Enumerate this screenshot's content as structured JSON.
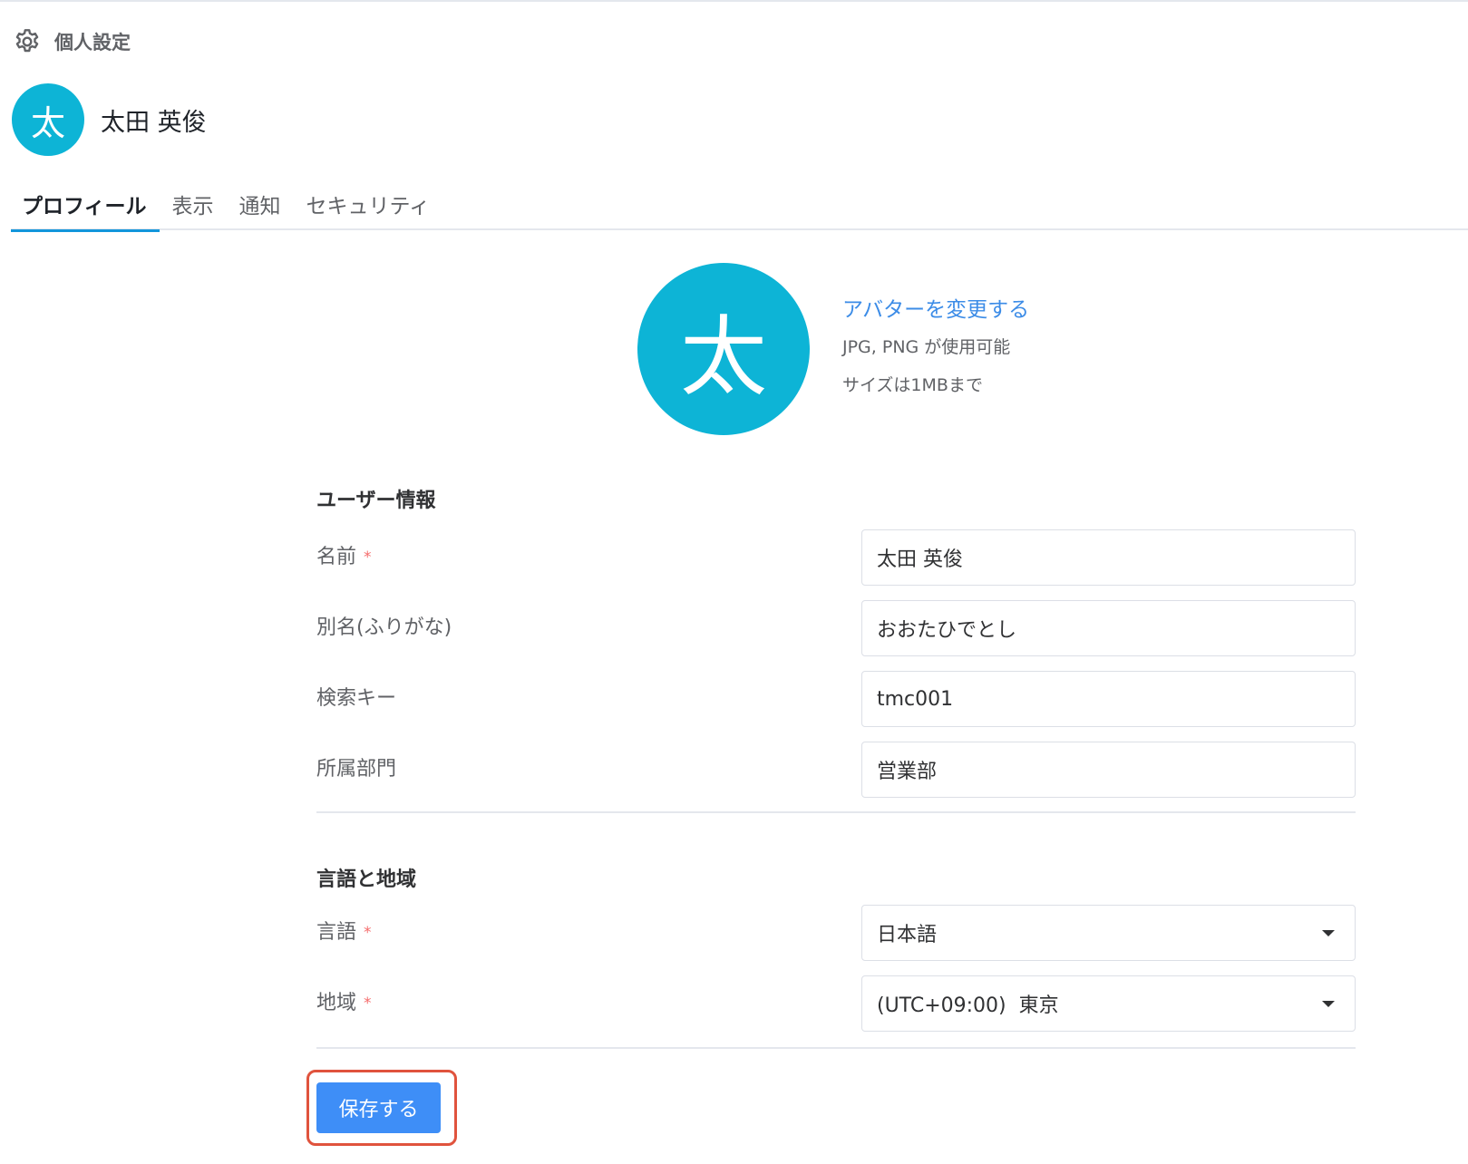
{
  "page": {
    "title": "個人設定",
    "icon": "gear-icon"
  },
  "user": {
    "avatar_char": "太",
    "name": "太田 英俊"
  },
  "tabs": [
    {
      "label": "プロフィール",
      "active": true
    },
    {
      "label": "表示",
      "active": false
    },
    {
      "label": "通知",
      "active": false
    },
    {
      "label": "セキュリティ",
      "active": false
    }
  ],
  "avatar": {
    "change_label": "アバターを変更する",
    "hint_formats": "JPG, PNG が使用可能",
    "hint_size": "サイズは1MBまで"
  },
  "user_info": {
    "title": "ユーザー情報",
    "fields": [
      {
        "label": "名前",
        "required": true,
        "value": "太田 英俊"
      },
      {
        "label": "別名(ふりがな)",
        "required": false,
        "value": "おおたひでとし"
      },
      {
        "label": "検索キー",
        "required": false,
        "value": "tmc001"
      },
      {
        "label": "所属部門",
        "required": false,
        "value": "営業部"
      }
    ]
  },
  "locale": {
    "title": "言語と地域",
    "fields": [
      {
        "label": "言語",
        "required": true,
        "value": "日本語"
      },
      {
        "label": "地域",
        "required": true,
        "value": "(UTC+09:00)  東京"
      }
    ]
  },
  "required_mark": "*",
  "save_label": "保存する",
  "colors": {
    "avatar": "#0db4d6",
    "link": "#3c8ce7",
    "primary_button": "#3e8ef7",
    "highlight": "#e0533d",
    "required": "#f56c6c"
  }
}
